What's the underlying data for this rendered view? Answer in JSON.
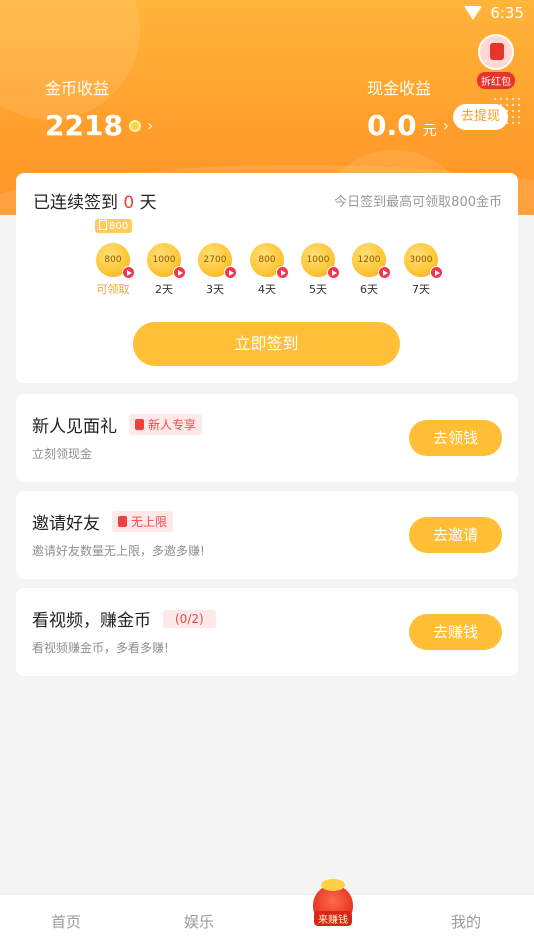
{
  "status_bar": {
    "time": "6:35"
  },
  "header": {
    "red_packet_label": "拆红包",
    "coin_earnings": {
      "label": "金币收益",
      "value": "2218"
    },
    "cash_earnings": {
      "label": "现金收益",
      "value": "0.0",
      "unit": "元"
    },
    "withdraw_button": "去提现",
    "colors": {
      "gradient_top": "#ffb53a",
      "gradient_bottom": "#ff952a"
    }
  },
  "checkin": {
    "title_prefix": "已连续签到",
    "streak": "0",
    "title_suffix": "天",
    "tip": "今日签到最高可领取800金币",
    "today_badge": "800",
    "days": [
      {
        "amount": "800",
        "label": "可领取",
        "active": true
      },
      {
        "amount": "1000",
        "label": "2天"
      },
      {
        "amount": "2700",
        "label": "3天"
      },
      {
        "amount": "800",
        "label": "4天"
      },
      {
        "amount": "1000",
        "label": "5天"
      },
      {
        "amount": "1200",
        "label": "6天"
      },
      {
        "amount": "3000",
        "label": "7天"
      }
    ],
    "sign_button": "立即签到"
  },
  "tasks": [
    {
      "title": "新人见面礼",
      "badge": "新人专享",
      "desc": "立刻领现金",
      "action": "去领钱"
    },
    {
      "title": "邀请好友",
      "badge": "无上限",
      "desc": "邀请好友数量无上限，多邀多赚!",
      "action": "去邀请"
    },
    {
      "title": "看视频，赚金币",
      "badge": "(0/2)",
      "desc": "看视频赚金币，多看多赚!",
      "action": "去赚钱"
    }
  ],
  "tabbar": {
    "home": "首页",
    "entertainment": "娱乐",
    "earn": "来赚钱",
    "mine": "我的"
  },
  "accent_color": "#ffbe33"
}
